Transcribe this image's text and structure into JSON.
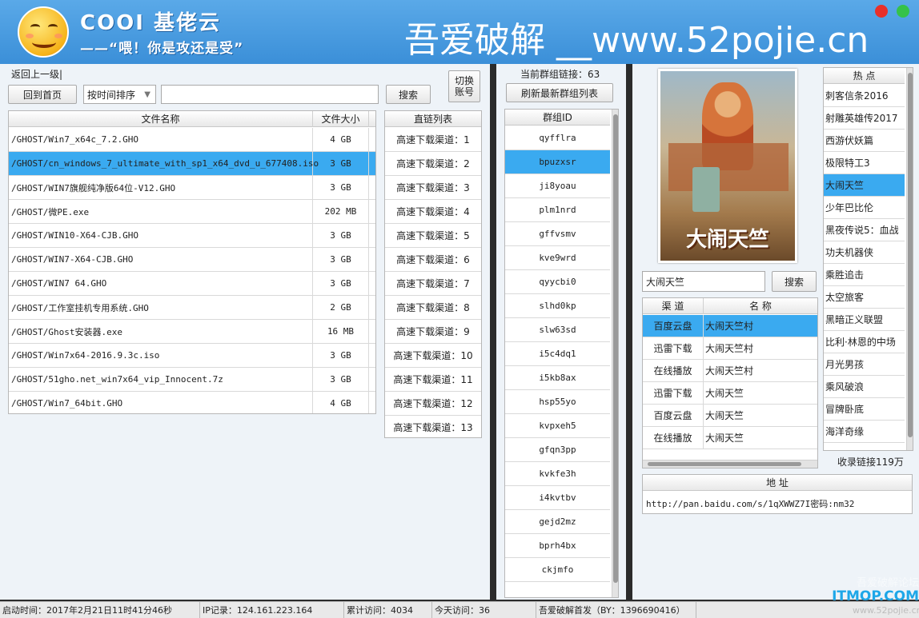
{
  "header": {
    "app_title": "COOI 基佬云",
    "slogan": "——“喂！你是攻还是受”",
    "banner": "吾爱破解 __www.52pojie.cn",
    "dot_colors": [
      "#e8302a",
      "#35c24a"
    ]
  },
  "left": {
    "back_label": "返回上一级|",
    "home_label": "回到首页",
    "sort_value": "按时间排序",
    "search_value": "",
    "search_label": "搜索",
    "switch_account_label": "切换账号",
    "columns": [
      "文件名称",
      "文件大小"
    ],
    "files": [
      {
        "name": "/GHOST/Win7_x64c_7.2.GHO",
        "size": "4 GB"
      },
      {
        "name": "/GHOST/cn_windows_7_ultimate_with_sp1_x64_dvd_u_677408.iso",
        "size": "3 GB"
      },
      {
        "name": "/GHOST/WIN7旗舰纯净版64位-V12.GHO",
        "size": "3 GB"
      },
      {
        "name": "/GHOST/微PE.exe",
        "size": "202 MB"
      },
      {
        "name": "/GHOST/WIN10-X64-CJB.GHO",
        "size": "3 GB"
      },
      {
        "name": "/GHOST/WIN7-X64-CJB.GHO",
        "size": "3 GB"
      },
      {
        "name": "/GHOST/WIN7 64.GHO",
        "size": "3 GB"
      },
      {
        "name": "/GHOST/工作室挂机专用系统.GHO",
        "size": "2 GB"
      },
      {
        "name": "/GHOST/Ghost安装器.exe",
        "size": "16 MB"
      },
      {
        "name": "/GHOST/Win7x64-2016.9.3c.iso",
        "size": "3 GB"
      },
      {
        "name": "/GHOST/51gho.net_win7x64_vip_Innocent.7z",
        "size": "3 GB"
      },
      {
        "name": "/GHOST/Win7_64bit.GHO",
        "size": "4 GB"
      }
    ],
    "selected_index": 1
  },
  "direct": {
    "header": "直链列表",
    "items": [
      "高速下载渠道：1",
      "高速下载渠道：2",
      "高速下载渠道：3",
      "高速下载渠道：4",
      "高速下载渠道：5",
      "高速下载渠道：6",
      "高速下载渠道：7",
      "高速下载渠道：8",
      "高速下载渠道：9",
      "高速下载渠道：10",
      "高速下载渠道：11",
      "高速下载渠道：12",
      "高速下载渠道：13"
    ]
  },
  "groups": {
    "count_label": "当前群组链接：63",
    "refresh_label": "刷新最新群组列表",
    "header": "群组ID",
    "ids": [
      "qyfflra",
      "bpuzxsr",
      "ji8yoau",
      "plm1nrd",
      "gffvsmv",
      "kve9wrd",
      "qyycbi0",
      "slhd0kp",
      "slw63sd",
      "i5c4dq1",
      "i5kb8ax",
      "hsp55yo",
      "kvpxeh5",
      "gfqn3pp",
      "kvkfe3h",
      "i4kvtbv",
      "gejd2mz",
      "bprh4bx",
      "ckjmfo"
    ],
    "selected_index": 1
  },
  "movie": {
    "poster_title": "大闹天竺",
    "search_value": "大闹天竺",
    "search_label": "搜索",
    "columns": [
      "渠 道",
      "名 称"
    ],
    "rows": [
      {
        "channel": "百度云盘",
        "name": "大闹天竺村"
      },
      {
        "channel": "迅雷下载",
        "name": "大闹天竺村"
      },
      {
        "channel": "在线播放",
        "name": "大闹天竺村"
      },
      {
        "channel": "迅雷下载",
        "name": "大闹天竺"
      },
      {
        "channel": "百度云盘",
        "name": "大闹天竺"
      },
      {
        "channel": "在线播放",
        "name": "大闹天竺"
      }
    ],
    "selected_index": 0,
    "address_header": "地 址",
    "address_value": "http://pan.baidu.com/s/1qXWWZ7I密码:nm32"
  },
  "hot": {
    "header": "热 点",
    "items": [
      "刺客信条2016",
      "射雕英雄传2017",
      "西游伏妖篇",
      "极限特工3",
      "大闹天竺",
      "少年巴比伦",
      "黑夜传说5：血战",
      "功夫机器侠",
      "乘胜追击",
      "太空旅客",
      "黑暗正义联盟",
      "比利·林恩的中场",
      "月光男孩",
      "乘风破浪",
      "冒牌卧底",
      "海洋奇缘"
    ],
    "selected_index": 4,
    "collected_label": "收录链接119万"
  },
  "footer": {
    "start_time": "启动时间：2017年2月21日11时41分46秒",
    "ip": "IP记录：124.161.223.164",
    "total_visits": "累计访问：4034",
    "today_visits": "今天访问：36",
    "credit": "吾爱破解首发（BY：1396690416）"
  },
  "watermark": {
    "line1": "吾爱破解论坛",
    "line2": "ITMOP.COM",
    "line3": "www.52pojie.cn"
  }
}
